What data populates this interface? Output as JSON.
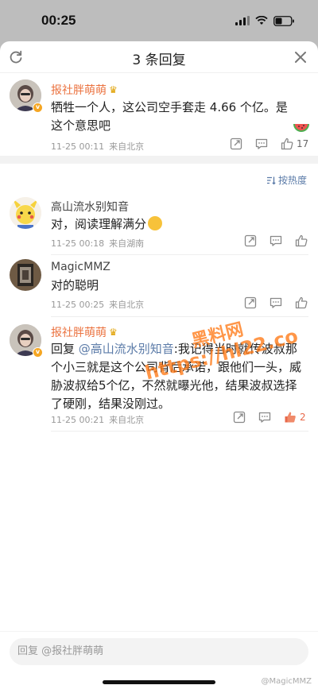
{
  "status_bar": {
    "time": "00:25"
  },
  "header": {
    "title": "3 条回复"
  },
  "root_comment": {
    "user": "报社胖萌萌",
    "text": "牺牲一个人，这公司空手套走 4.66 个亿。是这个意思吧",
    "date": "11-25 00:11",
    "source": "来自北京",
    "likes": "17"
  },
  "sort": {
    "label": "按热度"
  },
  "replies": [
    {
      "user": "高山流水别知音",
      "text": "对，阅读理解满分",
      "date": "11-25 00:18",
      "source": "来自湖南"
    },
    {
      "user": "MagicMMZ",
      "text": "对的聪明",
      "date": "11-25 00:25",
      "source": "来自北京"
    },
    {
      "user": "报社胖萌萌",
      "reply_prefix": "回复 ",
      "mention": "@高山流水别知音",
      "text": ":我记得当时就传波叔那个小三就是这个公司背后承诺，跟他们一头，威胁波叔给5个亿，不然就曝光他，结果波叔选择了硬刚，结果没刚过。",
      "date": "11-25 00:21",
      "source": "来自北京",
      "likes": "2"
    }
  ],
  "watermark": {
    "line1": "黑料网",
    "line2": "https://hl22.co"
  },
  "reply_box": {
    "placeholder": "回复 @报社胖萌萌"
  },
  "credit": "@MagicMMZ",
  "colors": {
    "accent_orange": "#eb7340",
    "link_blue": "#5b7ba8",
    "like_red": "#e8684a"
  }
}
